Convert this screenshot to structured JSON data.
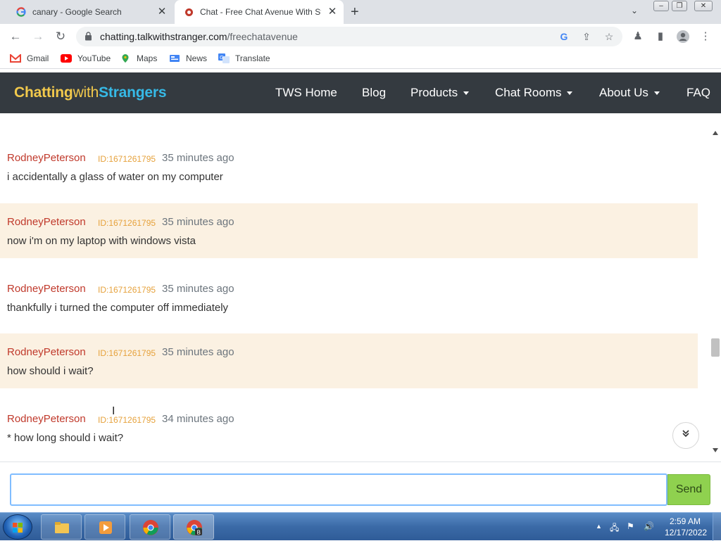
{
  "browser": {
    "tabs": [
      {
        "title": "canary - Google Search",
        "icon": "google-g-icon"
      },
      {
        "title": "Chat - Free Chat Avenue With Str",
        "icon": "tws-favicon"
      }
    ],
    "new_tab": "+",
    "url_domain": "chatting.talkwithstranger.com",
    "url_path": "/freechatavenue",
    "bookmarks": [
      {
        "label": "Gmail",
        "icon": "gmail-icon"
      },
      {
        "label": "YouTube",
        "icon": "youtube-icon"
      },
      {
        "label": "Maps",
        "icon": "maps-icon"
      },
      {
        "label": "News",
        "icon": "news-icon"
      },
      {
        "label": "Translate",
        "icon": "translate-icon"
      }
    ]
  },
  "site": {
    "logo_part1": "Chatting",
    "logo_part2": "with",
    "logo_part3": "Strangers",
    "nav": [
      {
        "label": "TWS Home",
        "dropdown": false
      },
      {
        "label": "Blog",
        "dropdown": false
      },
      {
        "label": "Products",
        "dropdown": true
      },
      {
        "label": "Chat Rooms",
        "dropdown": true
      },
      {
        "label": "About Us",
        "dropdown": true
      },
      {
        "label": "FAQ",
        "dropdown": false
      }
    ],
    "colors": {
      "nav_bg": "#343a40",
      "logo_yellow": "#f2c94c",
      "logo_blue": "#36b9e6",
      "username": "#c0392b",
      "uid": "#e6a23c",
      "alt_row": "#fbf1e2",
      "send": "#8fd14f"
    }
  },
  "chat": {
    "messages": [
      {
        "user": "RodneyPeterson",
        "uid": "ID:1671261795",
        "time": "35 minutes ago",
        "text": "i accidentally a glass of water on my computer",
        "highlight": false
      },
      {
        "user": "RodneyPeterson",
        "uid": "ID:1671261795",
        "time": "35 minutes ago",
        "text": "now i'm on my laptop with windows vista",
        "highlight": true
      },
      {
        "user": "RodneyPeterson",
        "uid": "ID:1671261795",
        "time": "35 minutes ago",
        "text": "thankfully i turned the computer off immediately",
        "highlight": false
      },
      {
        "user": "RodneyPeterson",
        "uid": "ID:1671261795",
        "time": "35 minutes ago",
        "text": "how should i wait?",
        "highlight": true
      },
      {
        "user": "RodneyPeterson",
        "uid": "ID:1671261795",
        "time": "34 minutes ago",
        "text": "* how long should i wait?",
        "highlight": false
      }
    ],
    "input_value": "",
    "input_placeholder": "",
    "send_label": "Send"
  },
  "taskbar": {
    "time": "2:59 AM",
    "date": "12/17/2022"
  }
}
